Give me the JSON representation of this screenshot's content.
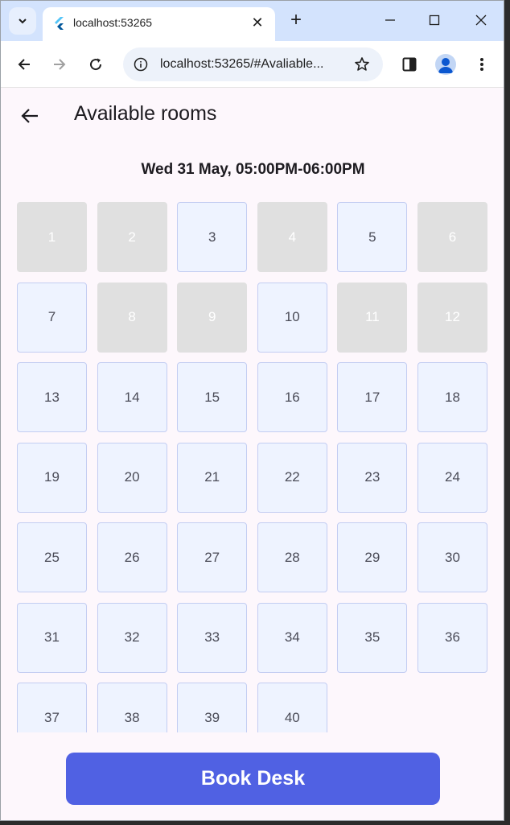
{
  "browser": {
    "tab_title": "localhost:53265",
    "url": "localhost:53265/#Avaliable...",
    "accent_color": "#d3e3fd"
  },
  "app": {
    "title": "Available rooms",
    "timeslot": "Wed 31 May, 05:00PM-06:00PM",
    "book_label": "Book Desk",
    "button_color": "#5061e3",
    "available_color": "#eef3ff",
    "unavailable_color": "#e0e0e0",
    "rooms": [
      {
        "n": "1",
        "available": false
      },
      {
        "n": "2",
        "available": false
      },
      {
        "n": "3",
        "available": true
      },
      {
        "n": "4",
        "available": false
      },
      {
        "n": "5",
        "available": true
      },
      {
        "n": "6",
        "available": false
      },
      {
        "n": "7",
        "available": true
      },
      {
        "n": "8",
        "available": false
      },
      {
        "n": "9",
        "available": false
      },
      {
        "n": "10",
        "available": true
      },
      {
        "n": "11",
        "available": false
      },
      {
        "n": "12",
        "available": false
      },
      {
        "n": "13",
        "available": true
      },
      {
        "n": "14",
        "available": true
      },
      {
        "n": "15",
        "available": true
      },
      {
        "n": "16",
        "available": true
      },
      {
        "n": "17",
        "available": true
      },
      {
        "n": "18",
        "available": true
      },
      {
        "n": "19",
        "available": true
      },
      {
        "n": "20",
        "available": true
      },
      {
        "n": "21",
        "available": true
      },
      {
        "n": "22",
        "available": true
      },
      {
        "n": "23",
        "available": true
      },
      {
        "n": "24",
        "available": true
      },
      {
        "n": "25",
        "available": true
      },
      {
        "n": "26",
        "available": true
      },
      {
        "n": "27",
        "available": true
      },
      {
        "n": "28",
        "available": true
      },
      {
        "n": "29",
        "available": true
      },
      {
        "n": "30",
        "available": true
      },
      {
        "n": "31",
        "available": true
      },
      {
        "n": "32",
        "available": true
      },
      {
        "n": "33",
        "available": true
      },
      {
        "n": "34",
        "available": true
      },
      {
        "n": "35",
        "available": true
      },
      {
        "n": "36",
        "available": true
      },
      {
        "n": "37",
        "available": true
      },
      {
        "n": "38",
        "available": true
      },
      {
        "n": "39",
        "available": true
      },
      {
        "n": "40",
        "available": true
      }
    ]
  }
}
